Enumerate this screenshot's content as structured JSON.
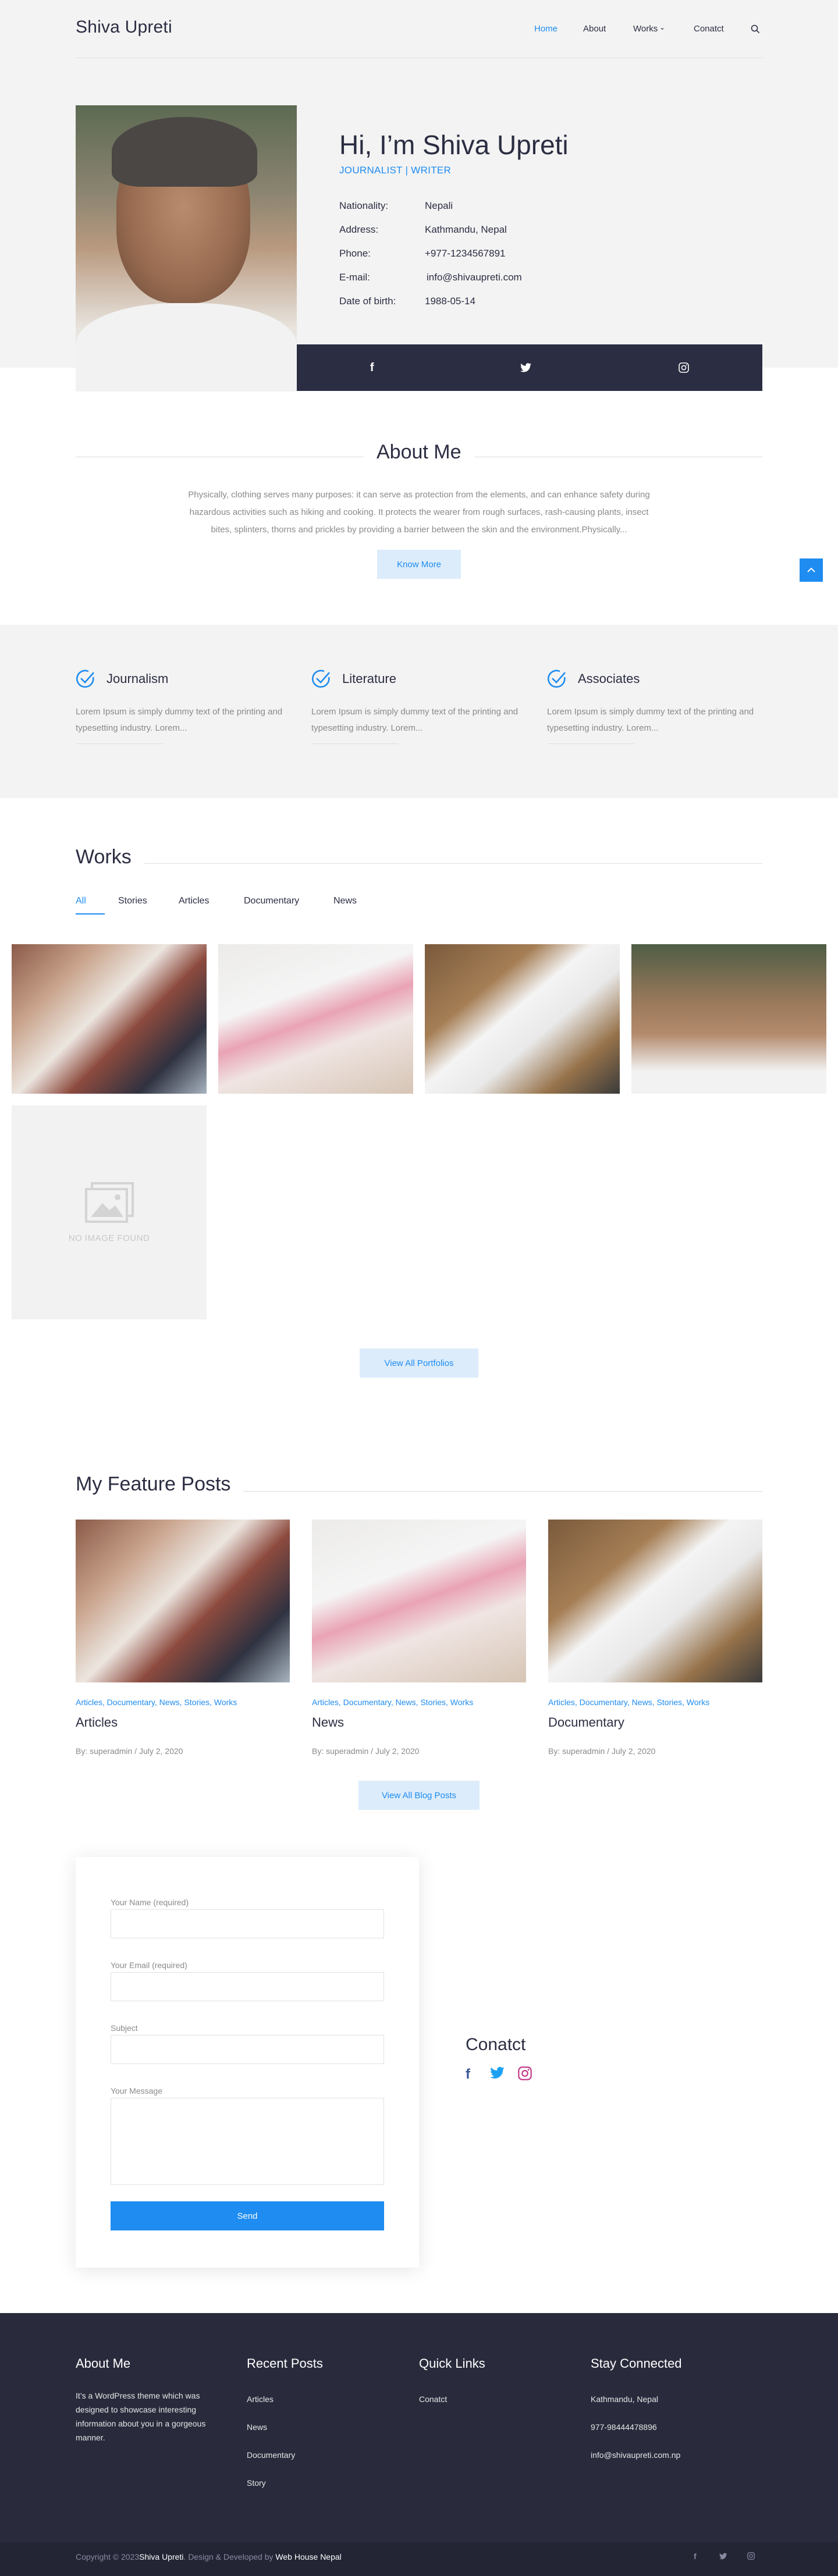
{
  "header": {
    "logo": "Shiva Upreti",
    "nav": [
      "Home",
      "About",
      "Works",
      "Conatct"
    ],
    "nav_active": "Home",
    "search_icon": "search-icon"
  },
  "hero": {
    "title": "Hi, I’m Shiva Upreti",
    "subtitle": "JOURNALIST | WRITER",
    "info": [
      {
        "label": "Nationality:",
        "value": "Nepali"
      },
      {
        "label": "Address:",
        "value": "Kathmandu, Nepal"
      },
      {
        "label": "Phone:",
        "value": "+977-1234567891"
      },
      {
        "label": "E-mail:",
        "value": "info@shivaupreti.com"
      },
      {
        "label": "Date of birth:",
        "value": "1988-05-14"
      }
    ],
    "social_icons": [
      "facebook-icon",
      "twitter-icon",
      "instagram-icon"
    ]
  },
  "about": {
    "title": "About Me",
    "text": "Physically, clothing serves many purposes: it can serve as protection from the elements, and can enhance safety during hazardous activities such as hiking and cooking. It protects the wearer from rough surfaces, rash-causing plants, insect bites, splinters, thorns and prickles by providing a barrier between the skin and the environment.Physically...",
    "button": "Know More"
  },
  "services": [
    {
      "title": "Journalism",
      "desc": "Lorem Ipsum is simply dummy text of the printing and typesetting industry. Lorem..."
    },
    {
      "title": "Literature",
      "desc": "Lorem Ipsum is simply dummy text of the printing and typesetting industry. Lorem..."
    },
    {
      "title": "Associates",
      "desc": "Lorem Ipsum is simply dummy text of the printing and typesetting industry. Lorem..."
    }
  ],
  "works": {
    "title": "Works",
    "tabs": [
      "All",
      "Stories",
      "Articles",
      "Documentary",
      "News"
    ],
    "active_tab": "All",
    "no_image": "NO IMAGE FOUND",
    "button": "View All Portfolios"
  },
  "feature": {
    "title": "My Feature Posts",
    "posts": [
      {
        "cats": "Articles, Documentary, News, Stories, Works",
        "title": "Articles",
        "meta": "By: superadmin / July 2, 2020"
      },
      {
        "cats": "Articles, Documentary, News, Stories, Works",
        "title": "News",
        "meta": "By: superadmin / July 2, 2020"
      },
      {
        "cats": "Articles, Documentary, News, Stories, Works",
        "title": "Documentary",
        "meta": "By: superadmin / July 2, 2020"
      }
    ],
    "button": "View All Blog Posts"
  },
  "form": {
    "name_label": "Your Name (required)",
    "email_label": "Your Email (required)",
    "subject_label": "Subject",
    "message_label": "Your Message",
    "send": "Send"
  },
  "contact": {
    "title": "Conatct",
    "icons": [
      "facebook-icon",
      "twitter-icon",
      "instagram-icon"
    ]
  },
  "footer": {
    "about_title": "About Me",
    "about_text": "It’s a WordPress theme which was designed to showcase interesting information about you in a gorgeous manner.",
    "recent_title": "Recent Posts",
    "recent": [
      "Articles",
      "News",
      "Documentary",
      "Story"
    ],
    "links_title": "Quick Links",
    "links": [
      "Conatct"
    ],
    "stay_title": "Stay Connected",
    "stay": [
      "Kathmandu, Nepal",
      "977-98444478896",
      "info@shivaupreti.com.np"
    ],
    "copy_pre": "Copyright © 2023",
    "copy_name": "Shiva Upreti",
    "copy_mid": ". Design & Developed by",
    "copy_dev": "Web House Nepal"
  },
  "colors": {
    "accent": "#1e8cf0",
    "dark": "#2b2d42",
    "footer": "#292b3c"
  }
}
